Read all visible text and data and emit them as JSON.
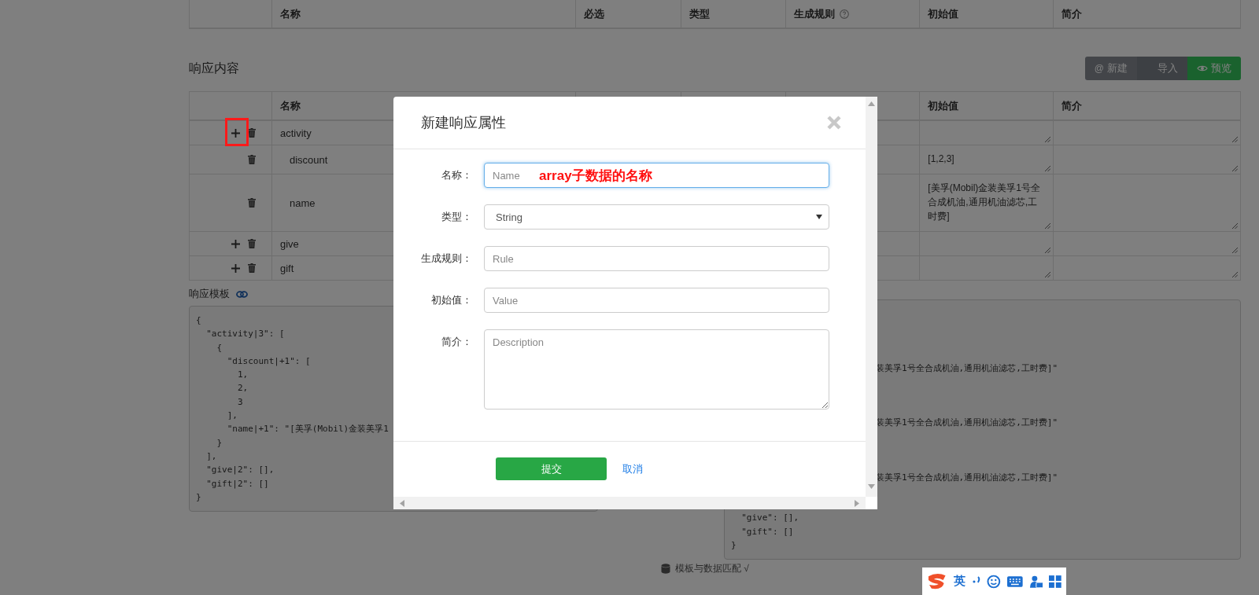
{
  "request_table": {
    "columns": [
      {
        "label": "名称",
        "help": false
      },
      {
        "label": "必选",
        "help": false
      },
      {
        "label": "类型",
        "help": false
      },
      {
        "label": "生成规则",
        "help": true
      },
      {
        "label": "初始值",
        "help": false
      },
      {
        "label": "简介",
        "help": false
      }
    ]
  },
  "response": {
    "title": "响应内容",
    "buttons": [
      {
        "kind": "new",
        "icon": "@",
        "label": "新建"
      },
      {
        "kind": "import",
        "label": "导入"
      },
      {
        "kind": "preview",
        "label": "预览"
      }
    ],
    "table": {
      "name_heading": "名称",
      "initial_heading": "初始值",
      "description_heading": "简介",
      "rows": [
        {
          "name": "activity",
          "can_add": true,
          "marked": true,
          "children": [
            {
              "name": "discount",
              "can_add": false,
              "marked": false,
              "initial": "[1,2,3]"
            },
            {
              "name": "name",
              "can_add": false,
              "marked": false,
              "initial": "[美孚(Mobil)金装美孚1号全合成机油,通用机油滤芯,工时费]"
            }
          ]
        },
        {
          "name": "give",
          "can_add": true,
          "marked": false
        },
        {
          "name": "gift",
          "can_add": true,
          "marked": false
        }
      ]
    }
  },
  "template": {
    "title": "响应模板",
    "left_lines": [
      "{",
      "  \"activity|3\": [",
      "    {",
      "      \"discount|+1\": [",
      "        1,",
      "        2,",
      "        3",
      "      ],",
      "      \"name|+1\": \"[美孚(Mobil)金装美孚1",
      "    }",
      "  ],",
      "  \"give|2\": [],",
      "  \"gift|2\": []",
      "}"
    ],
    "right_lines": [
      {
        "kind": "hidden"
      },
      {
        "kind": "hidden"
      },
      {
        "kind": "hidden"
      },
      {
        "kind": "hidden"
      },
      {
        "kind": "clipped",
        "text": "装美孚1号全合成机油,通用机油滤芯,工时费]\""
      },
      {
        "kind": "hidden"
      },
      {
        "kind": "hidden"
      },
      {
        "kind": "hidden"
      },
      {
        "kind": "clipped",
        "text": "装美孚1号全合成机油,通用机油滤芯,工时费]\""
      },
      {
        "kind": "hidden"
      },
      {
        "kind": "hidden"
      },
      {
        "kind": "hidden"
      },
      {
        "kind": "clipped",
        "text": "装美孚1号全合成机油,通用机油滤芯,工时费]\""
      },
      {
        "kind": "hidden"
      },
      {
        "kind": "hidden"
      },
      {
        "kind": "code",
        "text": "  \"give\": [],"
      },
      {
        "kind": "code",
        "text": "  \"gift\": []"
      },
      {
        "kind": "code",
        "text": "}"
      }
    ],
    "match_status": "模板与数据匹配 √"
  },
  "modal": {
    "title": "新建响应属性",
    "fields": [
      {
        "kind": "input",
        "label": "名称：",
        "placeholder": "Name",
        "focused": true
      },
      {
        "kind": "select",
        "label": "类型：",
        "value": "String",
        "focused": false
      },
      {
        "kind": "input",
        "label": "生成规则：",
        "placeholder": "Rule",
        "focused": false
      },
      {
        "kind": "input",
        "label": "初始值：",
        "placeholder": "Value",
        "focused": false
      },
      {
        "kind": "textarea",
        "label": "简介：",
        "placeholder": "Description",
        "focused": false
      }
    ],
    "submit": "提交",
    "cancel": "取消",
    "annotation": "array子数据的名称"
  },
  "ime": {
    "language": "英"
  }
}
